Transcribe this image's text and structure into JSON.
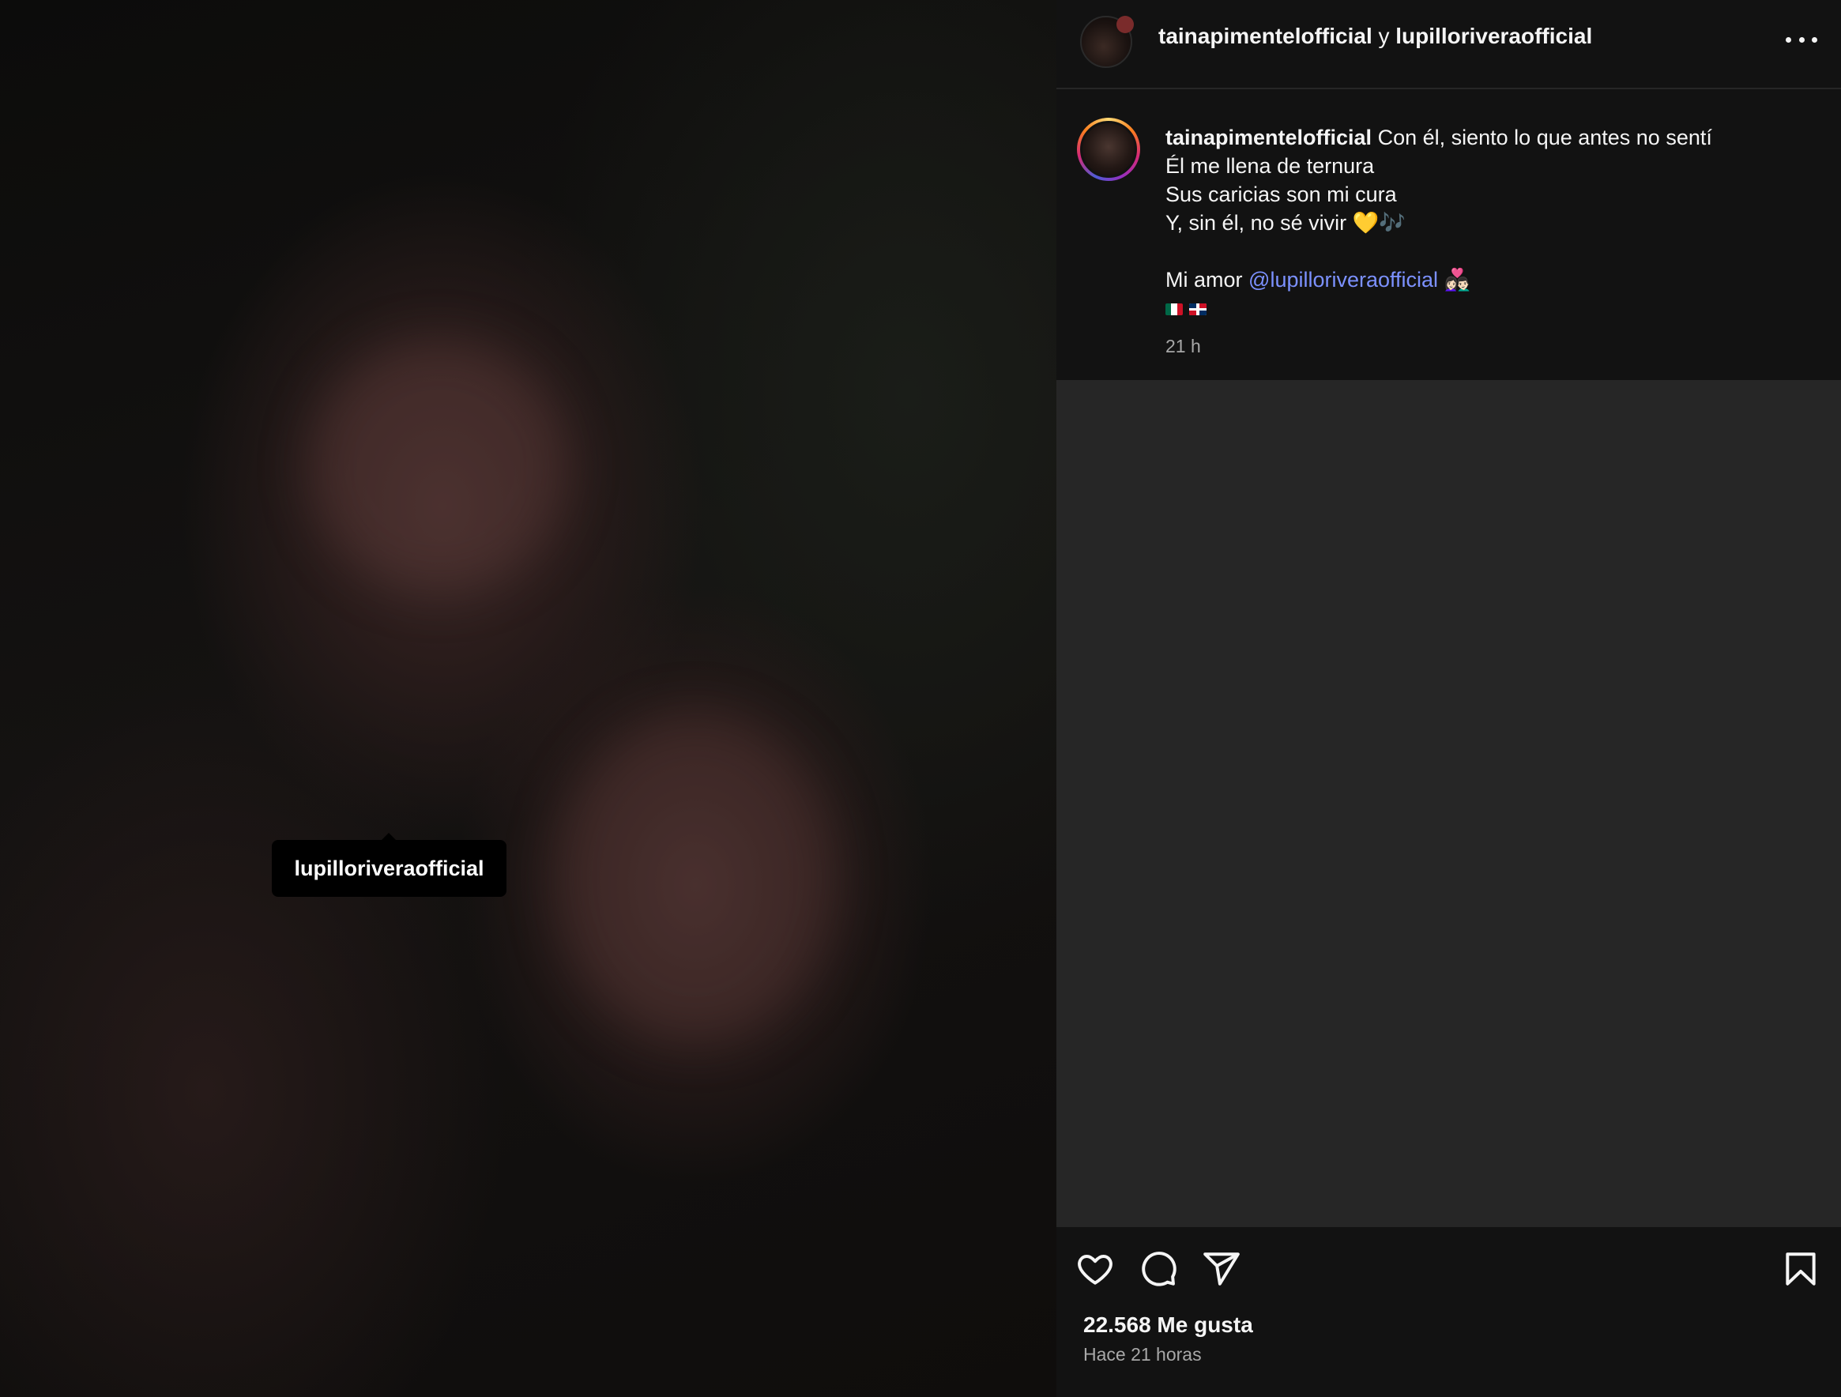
{
  "media": {
    "tag_username": "lupilloriveraofficial"
  },
  "header": {
    "user1": "tainapimentelofficial",
    "joiner": "y",
    "user2": "lupilloriveraofficial",
    "more_icon": "more-horizontal-icon"
  },
  "caption": {
    "username": "tainapimentelofficial",
    "lines": [
      "Con él, siento lo que antes no sentí",
      "Él me llena de ternura",
      "Sus caricias son mi cura",
      "Y, sin él, no sé vivir 💛🎶"
    ],
    "closing_prefix": "Mi amor",
    "mention": "@lupilloriveraofficial",
    "closing_emoji": "👩🏻‍❤️‍👨🏻",
    "flags": [
      "mexico-flag",
      "dominican-republic-flag"
    ],
    "time": "21 h"
  },
  "actions": {
    "icons": [
      "heart-icon",
      "comment-icon",
      "share-icon",
      "bookmark-icon"
    ],
    "likes": "22.568 Me gusta",
    "posted_ago": "Hace 21 horas"
  },
  "colors": {
    "panel_bg": "#121212",
    "empty_comments_bg": "#262626",
    "mention": "#7c91ff",
    "secondary_text": "#a8a8a8"
  }
}
